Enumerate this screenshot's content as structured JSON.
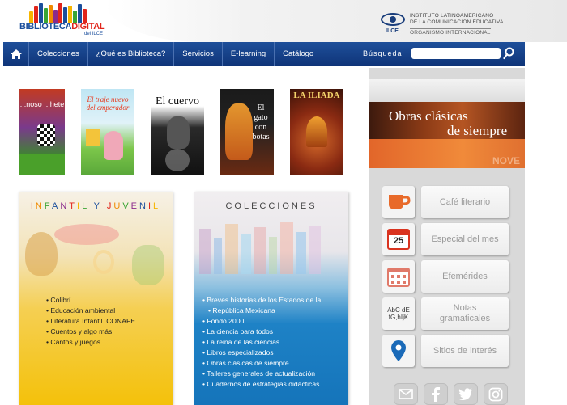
{
  "header": {
    "logo_text_1": "BIBLIOTECA",
    "logo_text_2": "DIGITAL",
    "logo_sub": "del ILCE",
    "org_abbr": "ILCE",
    "org_line1": "INSTITUTO LATINOAMERICANO",
    "org_line2": "DE LA COMUNICACIÓN EDUCATIVA",
    "org_line3": "ORGANISMO INTERNACIONAL"
  },
  "nav": {
    "items": [
      "Colecciones",
      "¿Qué es Biblioteca?",
      "Servicios",
      "E-learning",
      "Catálogo"
    ],
    "search_label": "Búsqueda",
    "search_value": ""
  },
  "books": [
    {
      "title": "...noso ...hete"
    },
    {
      "title": "El traje nuevo del emperador"
    },
    {
      "title": "El cuervo"
    },
    {
      "title": "El gato con botas"
    },
    {
      "title": "LA ILIADA"
    }
  ],
  "panels": {
    "infantil": {
      "title_parts": [
        "I",
        "N",
        "F",
        "A",
        "N",
        "T",
        "I",
        "L",
        " ",
        "Y",
        " ",
        "J",
        "U",
        "V",
        "E",
        "N",
        "I",
        "L"
      ],
      "items": [
        "Colibrí",
        "Educación ambiental",
        "Literatura Infantil. CONAFE",
        "Cuentos y algo más",
        "Cantos y juegos"
      ]
    },
    "colecciones": {
      "title": "COLECCIONES",
      "items": [
        "Breves historias de los Estados de la",
        "República Mexicana",
        "Fondo 2000",
        "La ciencia para todos",
        "La reina de las ciencias",
        "Libros especializados",
        "Obras clásicas de siempre",
        "Talleres generales de actualización",
        "Cuadernos de estrategias didácticas"
      ]
    }
  },
  "sidebar": {
    "banner_line1": "Obras clásicas",
    "banner_line2": "de siempre",
    "banner_watermark": "NOVE",
    "buttons": [
      {
        "label": "Café literario",
        "icon": "coffee-cup-icon"
      },
      {
        "label": "Especial del mes",
        "icon": "calendar-icon",
        "icon_text": "25"
      },
      {
        "label": "Efemérides",
        "icon": "calendar-grid-icon"
      },
      {
        "label": "Notas gramaticales",
        "icon": "grammar-icon",
        "icon_text_1": "AbC dE",
        "icon_text_2": "fG,hIjK"
      },
      {
        "label": "Sitios de interés",
        "icon": "location-pin-icon"
      }
    ],
    "social": [
      "mail-icon",
      "facebook-icon",
      "twitter-icon",
      "instagram-icon"
    ]
  },
  "colors": {
    "nav_blue": "#12397e",
    "infantil_yellow": "#f4c10a",
    "colecciones_blue": "#1574ba",
    "banner_orange": "#e2662a"
  }
}
